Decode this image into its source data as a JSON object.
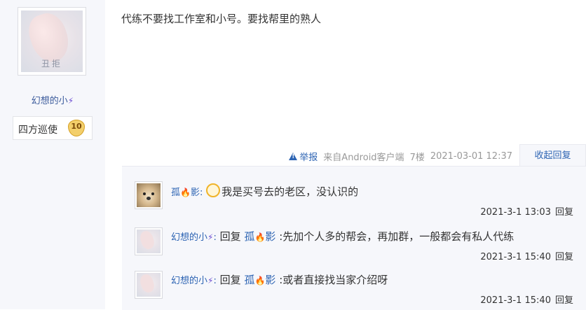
{
  "left": {
    "avatar_watermark": "丑拒",
    "username": "幻想的小",
    "rank": {
      "name": "四方巡使",
      "level": "10"
    }
  },
  "post": {
    "content": "代练不要找工作室和小号。要找帮里的熟人",
    "meta": {
      "report": "举报",
      "source": "来自Android客户端",
      "floor": "7楼",
      "time": "2021-03-01 12:37"
    },
    "collapse": "收起回复"
  },
  "replies": [
    {
      "user": "孤",
      "user_tail": "影",
      "sep": ":",
      "text": "我是买号去的老区，没认识的",
      "time": "2021-3-1 13:03",
      "reply_label": "回复"
    },
    {
      "user": "幻想的小",
      "sep": ":",
      "reply_word": "回复",
      "target": "孤",
      "target_tail": "影",
      "text": ":先加个人多的帮会，再加群，一般都会有私人代练",
      "time": "2021-3-1 15:40",
      "reply_label": "回复"
    },
    {
      "user": "幻想的小",
      "sep": ":",
      "reply_word": "回复",
      "target": "孤",
      "target_tail": "影",
      "text": ":或者直接找当家介绍呀",
      "time": "2021-3-1 15:40",
      "reply_label": "回复"
    }
  ],
  "icons": {
    "report": "warning-triangle-icon",
    "flame": "flame-icon",
    "bolt": "lightning-icon",
    "emoji": "emoji-bubble-icon"
  },
  "colors": {
    "link": "#2d64b3",
    "muted": "#999999",
    "panel": "#f6f7fb",
    "badge": "#f3cf6b"
  }
}
